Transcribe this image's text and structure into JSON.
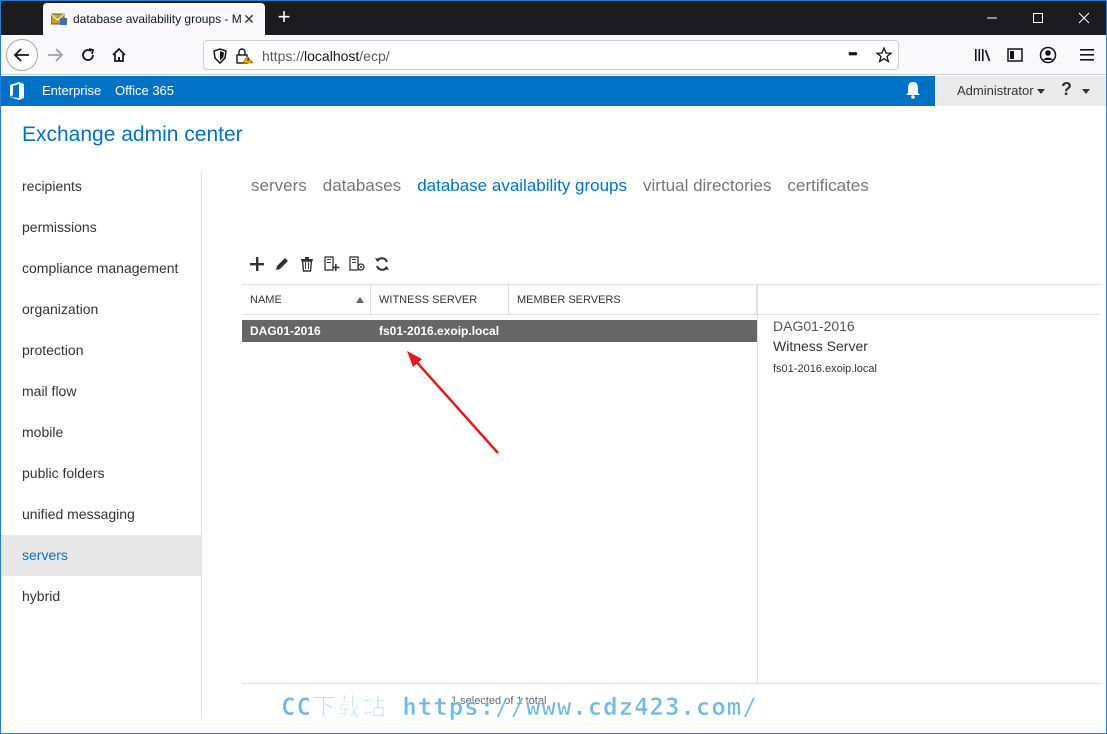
{
  "browser": {
    "tab_title": "database availability groups - M",
    "tab_close": "✕",
    "new_tab": "+",
    "url_prefix": "https://",
    "url_host": "localhost",
    "url_path": "/ecp/",
    "url_more": "•••"
  },
  "top_bar": {
    "enterprise": "Enterprise",
    "office365": "Office 365",
    "user": "Administrator",
    "help": "?",
    "color": "#0072c6"
  },
  "app_title": "Exchange admin center",
  "left_nav": [
    {
      "label": "recipients"
    },
    {
      "label": "permissions"
    },
    {
      "label": "compliance management"
    },
    {
      "label": "organization"
    },
    {
      "label": "protection"
    },
    {
      "label": "mail flow"
    },
    {
      "label": "mobile"
    },
    {
      "label": "public folders"
    },
    {
      "label": "unified messaging"
    },
    {
      "label": "servers",
      "selected": true
    },
    {
      "label": "hybrid"
    }
  ],
  "sub_tabs": [
    {
      "label": "servers"
    },
    {
      "label": "databases"
    },
    {
      "label": "database availability groups",
      "active": true
    },
    {
      "label": "virtual directories"
    },
    {
      "label": "certificates"
    }
  ],
  "toolbar": [
    "add-icon",
    "edit-icon",
    "delete-icon",
    "add-server-icon",
    "network-icon",
    "refresh-icon"
  ],
  "grid": {
    "columns": [
      "NAME",
      "WITNESS SERVER",
      "MEMBER SERVERS"
    ],
    "rows": [
      {
        "name": "DAG01-2016",
        "witness": "fs01-2016.exoip.local",
        "members": ""
      }
    ]
  },
  "detail": {
    "title": "DAG01-2016",
    "label": "Witness Server",
    "value": "fs01-2016.exoip.local"
  },
  "status": "1 selected of 1 total",
  "watermark": "CC下载站 https://www.cdz423.com/"
}
